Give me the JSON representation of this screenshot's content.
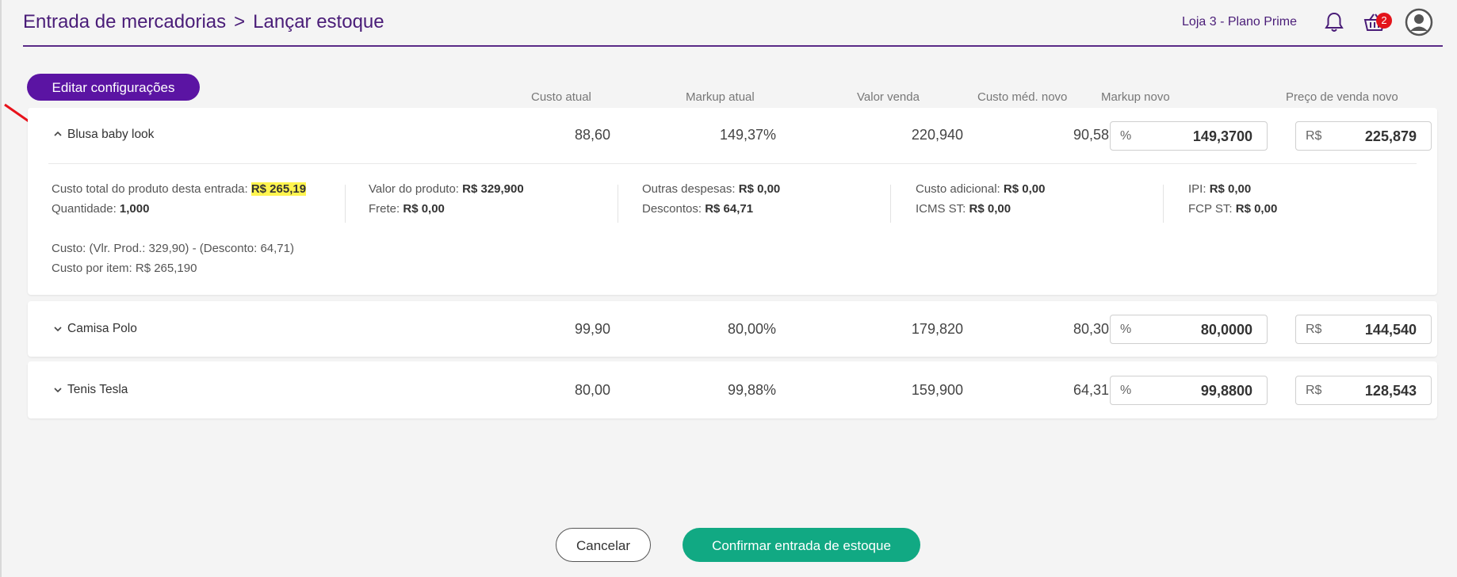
{
  "header": {
    "breadcrumb_parent": "Entrada de mercadorias",
    "breadcrumb_sep": ">",
    "breadcrumb_current": "Lançar estoque",
    "store": "Loja 3 - Plano Prime",
    "cart_count": "2",
    "icons": [
      "bell-icon",
      "basket-icon",
      "user-avatar-icon"
    ]
  },
  "toolbar": {
    "edit_label": "Editar configurações"
  },
  "columns": {
    "custo_atual": "Custo atual",
    "markup_atual": "Markup atual",
    "valor_venda": "Valor venda",
    "custo_med_novo": "Custo méd. novo",
    "markup_novo": "Markup novo",
    "preco_venda_novo": "Preço de venda novo"
  },
  "products": [
    {
      "name": "Blusa baby look",
      "custo_atual": "88,60",
      "markup_atual": "149,37%",
      "valor_venda": "220,940",
      "custo_med_novo": "90,58",
      "markup_prefix": "%",
      "markup_novo": "149,3700",
      "preco_prefix": "R$",
      "preco_venda_novo": "225,879",
      "expanded": true
    },
    {
      "name": "Camisa Polo",
      "custo_atual": "99,90",
      "markup_atual": "80,00%",
      "valor_venda": "179,820",
      "custo_med_novo": "80,30",
      "markup_prefix": "%",
      "markup_novo": "80,0000",
      "preco_prefix": "R$",
      "preco_venda_novo": "144,540",
      "expanded": false
    },
    {
      "name": "Tenis Tesla",
      "custo_atual": "80,00",
      "markup_atual": "99,88%",
      "valor_venda": "159,900",
      "custo_med_novo": "64,31",
      "markup_prefix": "%",
      "markup_novo": "99,8800",
      "preco_prefix": "R$",
      "preco_venda_novo": "128,543",
      "expanded": false
    }
  ],
  "details": {
    "custo_total_label": "Custo total do produto desta entrada:",
    "custo_total_value": "R$ 265,19",
    "quantidade_label": "Quantidade:",
    "quantidade_value": "1,000",
    "valor_produto_label": "Valor do produto:",
    "valor_produto_value": "R$ 329,900",
    "frete_label": "Frete:",
    "frete_value": "R$ 0,00",
    "outras_label": "Outras despesas:",
    "outras_value": "R$ 0,00",
    "descontos_label": "Descontos:",
    "descontos_value": "R$ 64,71",
    "custo_adicional_label": "Custo adicional:",
    "custo_adicional_value": "R$ 0,00",
    "icms_label": "ICMS ST:",
    "icms_value": "R$ 0,00",
    "ipi_label": "IPI:",
    "ipi_value": "R$ 0,00",
    "fcp_label": "FCP ST:",
    "fcp_value": "R$ 0,00",
    "formula": "Custo: (Vlr. Prod.: 329,90) - (Desconto: 64,71)",
    "custo_por_item": "Custo por item: R$ 265,190"
  },
  "footer": {
    "cancel_label": "Cancelar",
    "confirm_label": "Confirmar entrada de estoque"
  },
  "colors": {
    "primary": "#5b14a3",
    "confirm": "#11a983",
    "highlight": "#fff44f",
    "badge": "#e3141b",
    "annotation_arrow": "#e8121b"
  }
}
